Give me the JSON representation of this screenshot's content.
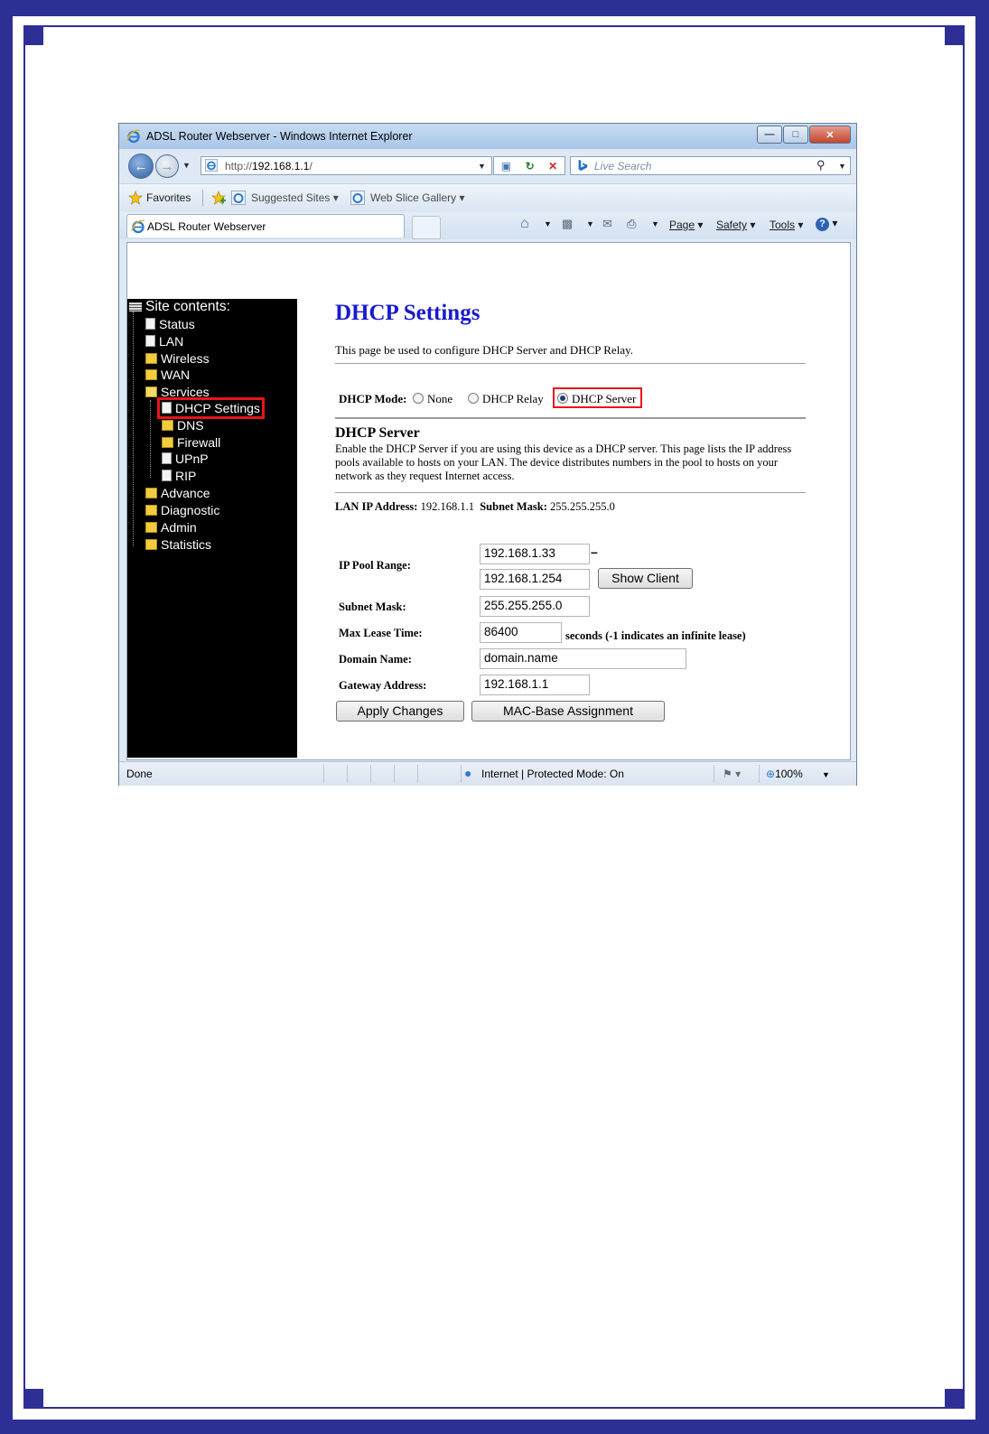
{
  "browser": {
    "title": "ADSL Router Webserver - Windows Internet Explorer",
    "address_prefix": "http://",
    "address_host": "192.168.1.1",
    "address_suffix": "/",
    "search_placeholder": "Live Search",
    "favorites_label": "Favorites",
    "suggested_sites_label": "Suggested Sites",
    "web_slice_label": "Web Slice Gallery",
    "tab_title": "ADSL Router Webserver",
    "cmd_page": "Page",
    "cmd_safety": "Safety",
    "cmd_tools": "Tools",
    "status_left": "Done",
    "status_zone": "Internet | Protected Mode: On",
    "zoom": "100%"
  },
  "tree": {
    "root": "Site contents:",
    "items": [
      {
        "label": "Status",
        "type": "doc"
      },
      {
        "label": "LAN",
        "type": "doc"
      },
      {
        "label": "Wireless",
        "type": "folder"
      },
      {
        "label": "WAN",
        "type": "folder"
      },
      {
        "label": "Services",
        "type": "folder-open"
      },
      {
        "label": "DHCP Settings",
        "type": "doc"
      },
      {
        "label": "DNS",
        "type": "folder"
      },
      {
        "label": "Firewall",
        "type": "folder"
      },
      {
        "label": "UPnP",
        "type": "doc"
      },
      {
        "label": "RIP",
        "type": "doc"
      },
      {
        "label": "Advance",
        "type": "folder"
      },
      {
        "label": "Diagnostic",
        "type": "folder"
      },
      {
        "label": "Admin",
        "type": "folder"
      },
      {
        "label": "Statistics",
        "type": "folder"
      }
    ]
  },
  "page": {
    "heading": "DHCP Settings",
    "description": "This page be used to configure DHCP Server and DHCP Relay.",
    "mode_label": "DHCP Mode:",
    "mode_options": [
      "None",
      "DHCP Relay",
      "DHCP Server"
    ],
    "mode_selected": "DHCP Server",
    "server_title": "DHCP Server",
    "server_desc": "Enable the DHCP Server if you are using this device as a DHCP server. This page lists the IP address pools available to hosts on your LAN. The device distributes numbers in the pool to hosts on your network as they request Internet access.",
    "lan_ip_label": "LAN IP Address:",
    "lan_ip_value": "192.168.1.1",
    "subnet_label_inline": "Subnet Mask:",
    "subnet_value_inline": "255.255.255.0",
    "pool_label": "IP Pool Range:",
    "pool_start": "192.168.1.33",
    "pool_dash": "–",
    "pool_end": "192.168.1.254",
    "show_client": "Show Client",
    "subnet_label": "Subnet Mask:",
    "subnet_value": "255.255.255.0",
    "lease_label": "Max Lease Time:",
    "lease_value": "86400",
    "lease_note": "seconds (-1 indicates an infinite lease)",
    "domain_label": "Domain Name:",
    "domain_value": "domain.name",
    "gateway_label": "Gateway Address:",
    "gateway_value": "192.168.1.1",
    "apply_button": "Apply Changes",
    "mac_button": "MAC-Base Assignment"
  },
  "colors": {
    "frame": "#2e2f95",
    "heading": "#1a1acd",
    "highlight": "#e8141b"
  }
}
